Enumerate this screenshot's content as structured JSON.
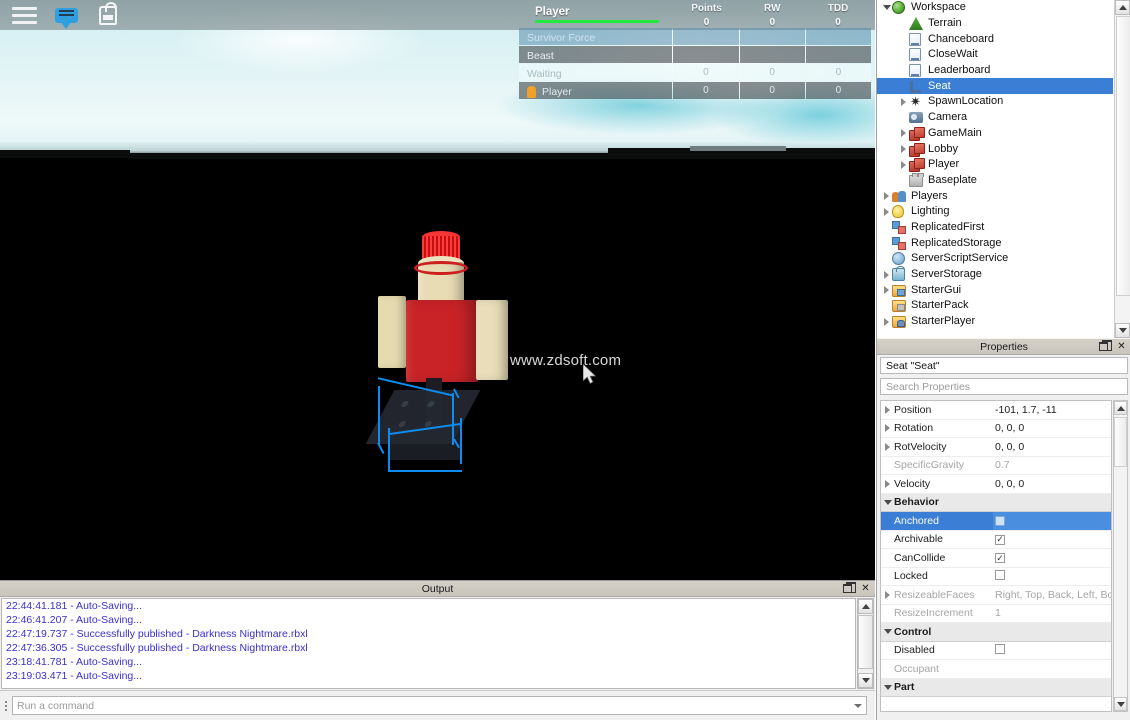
{
  "hud": {
    "menu_icon": "hamburger-icon",
    "chat_icon": "chat-bubble-icon",
    "backpack_icon": "backpack-icon"
  },
  "leaderboard": {
    "name_column": "Player",
    "stat_columns": [
      {
        "title": "Points",
        "total": "0"
      },
      {
        "title": "RW",
        "total": "0"
      },
      {
        "title": "TDD",
        "total": "0"
      }
    ],
    "accent_color": "#23e83f",
    "rows": [
      {
        "label": "Survivor Force",
        "values": [
          "",
          "",
          ""
        ],
        "style": "team-blue"
      },
      {
        "label": "Beast",
        "values": [
          "",
          "",
          ""
        ],
        "style": "team-dark"
      },
      {
        "label": "Waiting",
        "values": [
          "0",
          "0",
          "0"
        ],
        "style": "team-light"
      },
      {
        "label": "Player",
        "values": [
          "0",
          "0",
          "0"
        ],
        "style": "player-row"
      }
    ]
  },
  "viewport": {
    "watermark": "www.zdsoft.com",
    "selection_color": "#0f8cf0",
    "cursor_icon": "mouse-pointer-icon"
  },
  "output": {
    "title": "Output",
    "restore_icon": "restore-window-icon",
    "close_icon": "close-icon",
    "lines": [
      "22:44:41.181 - Auto-Saving...",
      "22:46:41.207 - Auto-Saving...",
      "22:47:19.737 - Successfully published - Darkness Nightmare.rbxl",
      "22:47:36.305 - Successfully published - Darkness Nightmare.rbxl",
      "23:18:41.781 - Auto-Saving...",
      "23:19:03.471 - Auto-Saving..."
    ]
  },
  "command_bar": {
    "placeholder": "Run a command",
    "grip_icon": "drag-grip-icon",
    "dropdown_icon": "chevron-down-icon"
  },
  "explorer": {
    "items": [
      {
        "label": "Workspace",
        "indent": 0,
        "twisty": "open",
        "icon": "globe-icon",
        "selected": false
      },
      {
        "label": "Terrain",
        "indent": 1,
        "twisty": "none",
        "icon": "terrain-icon",
        "selected": false
      },
      {
        "label": "Chanceboard",
        "indent": 1,
        "twisty": "none",
        "icon": "script-icon",
        "selected": false
      },
      {
        "label": "CloseWait",
        "indent": 1,
        "twisty": "none",
        "icon": "script-icon",
        "selected": false
      },
      {
        "label": "Leaderboard",
        "indent": 1,
        "twisty": "none",
        "icon": "script-icon",
        "selected": false
      },
      {
        "label": "Seat",
        "indent": 1,
        "twisty": "none",
        "icon": "seat-icon",
        "selected": true
      },
      {
        "label": "SpawnLocation",
        "indent": 1,
        "twisty": "closed",
        "icon": "spawn-location-icon",
        "selected": false
      },
      {
        "label": "Camera",
        "indent": 1,
        "twisty": "none",
        "icon": "camera-icon",
        "selected": false
      },
      {
        "label": "GameMain",
        "indent": 1,
        "twisty": "closed",
        "icon": "model-icon",
        "selected": false
      },
      {
        "label": "Lobby",
        "indent": 1,
        "twisty": "closed",
        "icon": "model-icon",
        "selected": false
      },
      {
        "label": "Player",
        "indent": 1,
        "twisty": "closed",
        "icon": "model-icon",
        "selected": false
      },
      {
        "label": "Baseplate",
        "indent": 1,
        "twisty": "none",
        "icon": "brick-icon",
        "selected": false
      },
      {
        "label": "Players",
        "indent": 0,
        "twisty": "closed",
        "icon": "players-icon",
        "selected": false
      },
      {
        "label": "Lighting",
        "indent": 0,
        "twisty": "closed",
        "icon": "lightbulb-icon",
        "selected": false
      },
      {
        "label": "ReplicatedFirst",
        "indent": 0,
        "twisty": "none",
        "icon": "replicated-icon",
        "selected": false
      },
      {
        "label": "ReplicatedStorage",
        "indent": 0,
        "twisty": "none",
        "icon": "replicated-icon",
        "selected": false
      },
      {
        "label": "ServerScriptService",
        "indent": 0,
        "twisty": "none",
        "icon": "server-script-icon",
        "selected": false
      },
      {
        "label": "ServerStorage",
        "indent": 0,
        "twisty": "closed",
        "icon": "server-storage-icon",
        "selected": false
      },
      {
        "label": "StarterGui",
        "indent": 0,
        "twisty": "closed",
        "icon": "starter-gui-icon",
        "selected": false
      },
      {
        "label": "StarterPack",
        "indent": 0,
        "twisty": "none",
        "icon": "starter-pack-icon",
        "selected": false
      },
      {
        "label": "StarterPlayer",
        "indent": 0,
        "twisty": "closed",
        "icon": "starter-player-icon",
        "selected": false
      }
    ]
  },
  "properties": {
    "title": "Properties",
    "restore_icon": "restore-window-icon",
    "close_icon": "close-icon",
    "object_name": "Seat \"Seat\"",
    "search_placeholder": "Search Properties",
    "rows": [
      {
        "kind": "prop",
        "name": "Position",
        "value": "-101, 1.7, -11",
        "expandable": true,
        "dim": false,
        "selected": false,
        "widget": "text"
      },
      {
        "kind": "prop",
        "name": "Rotation",
        "value": "0, 0, 0",
        "expandable": true,
        "dim": false,
        "selected": false,
        "widget": "text"
      },
      {
        "kind": "prop",
        "name": "RotVelocity",
        "value": "0, 0, 0",
        "expandable": true,
        "dim": false,
        "selected": false,
        "widget": "text"
      },
      {
        "kind": "prop",
        "name": "SpecificGravity",
        "value": "0.7",
        "expandable": false,
        "dim": true,
        "selected": false,
        "widget": "text"
      },
      {
        "kind": "prop",
        "name": "Velocity",
        "value": "0, 0, 0",
        "expandable": true,
        "dim": false,
        "selected": false,
        "widget": "text"
      },
      {
        "kind": "category",
        "name": "Behavior",
        "value": "",
        "expandable": false,
        "dim": false,
        "selected": false,
        "widget": "none"
      },
      {
        "kind": "prop",
        "name": "Anchored",
        "value": "",
        "expandable": false,
        "dim": false,
        "selected": true,
        "widget": "checkbox-unchecked-blue"
      },
      {
        "kind": "prop",
        "name": "Archivable",
        "value": "",
        "expandable": false,
        "dim": false,
        "selected": false,
        "widget": "checkbox-checked"
      },
      {
        "kind": "prop",
        "name": "CanCollide",
        "value": "",
        "expandable": false,
        "dim": false,
        "selected": false,
        "widget": "checkbox-checked"
      },
      {
        "kind": "prop",
        "name": "Locked",
        "value": "",
        "expandable": false,
        "dim": false,
        "selected": false,
        "widget": "checkbox-unchecked"
      },
      {
        "kind": "prop",
        "name": "ResizeableFaces",
        "value": "Right, Top, Back, Left, Bot...",
        "expandable": true,
        "dim": true,
        "selected": false,
        "widget": "text"
      },
      {
        "kind": "prop",
        "name": "ResizeIncrement",
        "value": "1",
        "expandable": false,
        "dim": true,
        "selected": false,
        "widget": "text"
      },
      {
        "kind": "category",
        "name": "Control",
        "value": "",
        "expandable": false,
        "dim": false,
        "selected": false,
        "widget": "none"
      },
      {
        "kind": "prop",
        "name": "Disabled",
        "value": "",
        "expandable": false,
        "dim": false,
        "selected": false,
        "widget": "checkbox-unchecked"
      },
      {
        "kind": "prop",
        "name": "Occupant",
        "value": "",
        "expandable": false,
        "dim": true,
        "selected": false,
        "widget": "text"
      },
      {
        "kind": "category",
        "name": "Part",
        "value": "",
        "expandable": false,
        "dim": false,
        "selected": false,
        "widget": "none"
      }
    ]
  }
}
